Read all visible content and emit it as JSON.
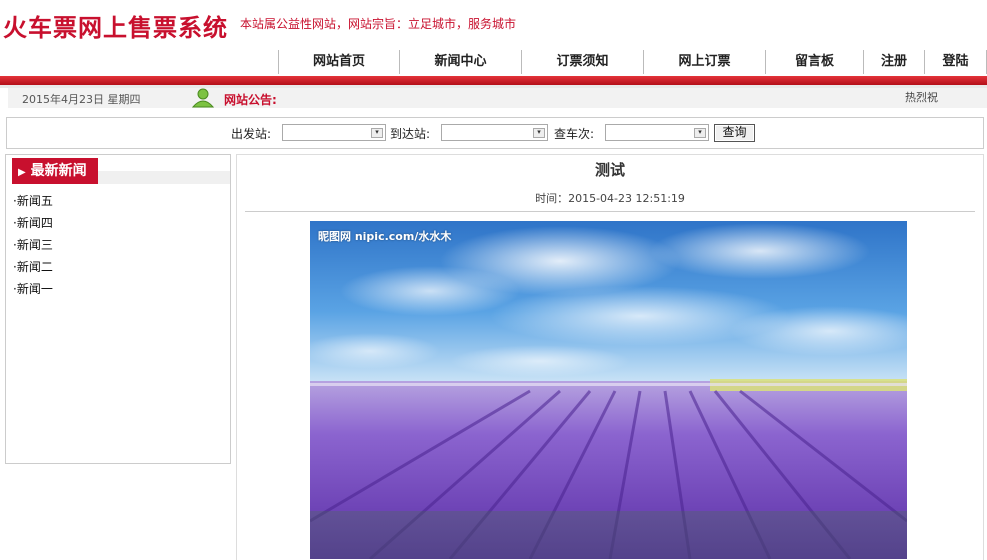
{
  "header": {
    "site_title": "火车票网上售票系统",
    "slogan": "本站属公益性网站，网站宗旨：立足城市，服务城市"
  },
  "nav": {
    "items": [
      {
        "label": "网站首页"
      },
      {
        "label": "新闻中心"
      },
      {
        "label": "订票须知"
      },
      {
        "label": "网上订票"
      },
      {
        "label": "留言板"
      },
      {
        "label": "注册"
      },
      {
        "label": "登陆"
      }
    ]
  },
  "notice": {
    "date": "2015年4月23日 星期四",
    "label": "网站公告:",
    "hot_label": "热烈祝"
  },
  "search": {
    "from_label": "出发站:",
    "to_label": "到达站:",
    "train_label": "查车次:",
    "from_value": "",
    "to_value": "",
    "train_value": "",
    "button_label": "查询"
  },
  "sidebar": {
    "title": "最新新闻",
    "items": [
      {
        "label": "·新闻五"
      },
      {
        "label": "·新闻四"
      },
      {
        "label": "·新闻三"
      },
      {
        "label": "·新闻二"
      },
      {
        "label": "·新闻一"
      }
    ]
  },
  "article": {
    "title": "测试",
    "time": "时间：2015-04-23 12:51:19",
    "image_watermark": "昵图网 nipic.com/水水木"
  },
  "colors": {
    "brand_red": "#c8102e",
    "sky": "#3a8bd6",
    "lavender": "#7a4fc4"
  }
}
